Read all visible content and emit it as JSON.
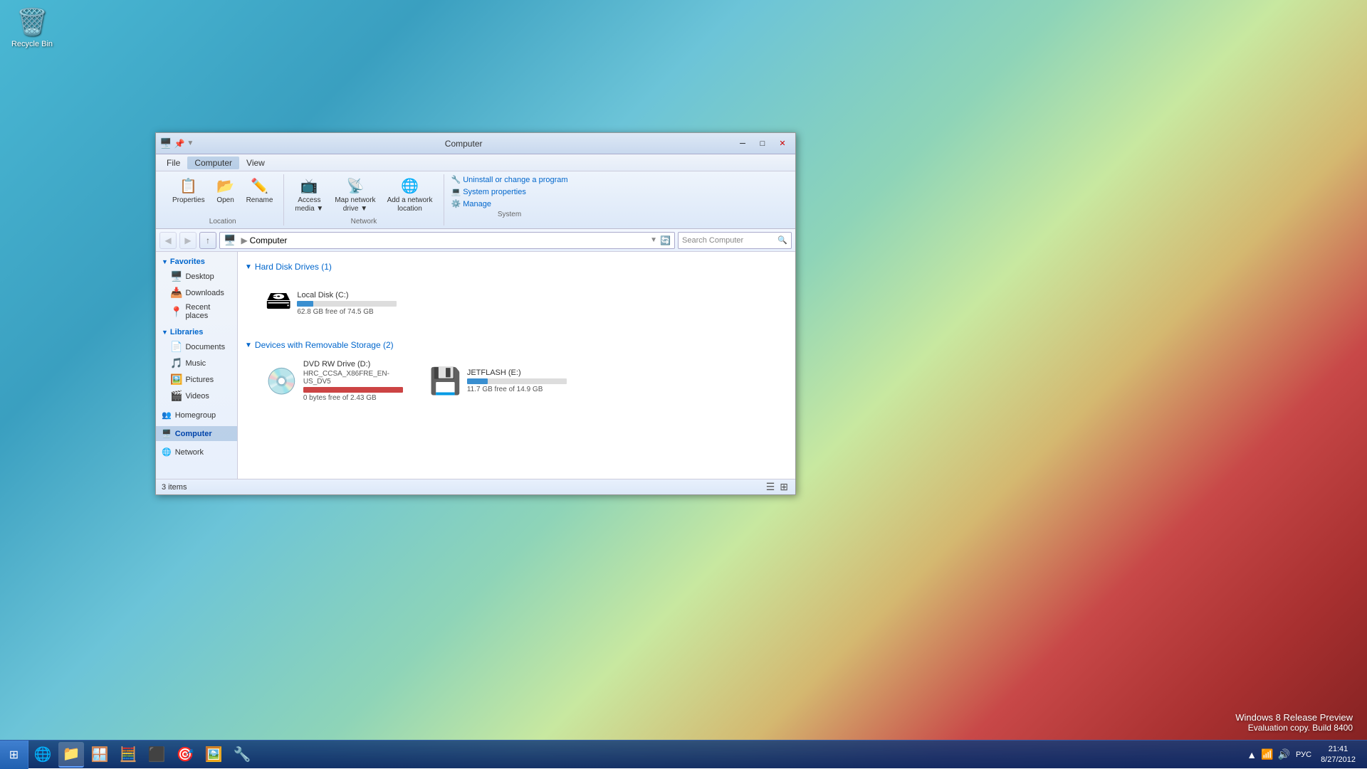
{
  "desktop": {
    "recycle_bin_label": "Recycle Bin"
  },
  "window": {
    "title": "Computer",
    "title_icon": "🖥️"
  },
  "titlebar": {
    "minimize": "─",
    "maximize": "□",
    "close": "✕"
  },
  "menubar": {
    "items": [
      "File",
      "Computer",
      "View"
    ]
  },
  "ribbon": {
    "location_group": {
      "label": "Location",
      "buttons": [
        {
          "icon": "📋",
          "label": "Properties"
        },
        {
          "icon": "📂",
          "label": "Open"
        },
        {
          "icon": "✏️",
          "label": "Rename"
        }
      ]
    },
    "network_group": {
      "label": "Network",
      "buttons": [
        {
          "icon": "🗺️",
          "label": "Access media"
        },
        {
          "icon": "📡",
          "label": "Map network drive"
        },
        {
          "icon": "🌐",
          "label": "Add a network location"
        }
      ]
    },
    "system_group": {
      "label": "System",
      "links": [
        "Uninstall or change a program",
        "System properties",
        "Manage"
      ]
    }
  },
  "navbar": {
    "address": "Computer",
    "search_placeholder": "Search Computer"
  },
  "sidebar": {
    "favorites_label": "Favorites",
    "favorites_items": [
      {
        "icon": "🖥️",
        "label": "Desktop"
      },
      {
        "icon": "📥",
        "label": "Downloads"
      },
      {
        "icon": "📍",
        "label": "Recent places"
      }
    ],
    "libraries_label": "Libraries",
    "libraries_items": [
      {
        "icon": "📄",
        "label": "Documents"
      },
      {
        "icon": "🎵",
        "label": "Music"
      },
      {
        "icon": "🖼️",
        "label": "Pictures"
      },
      {
        "icon": "🎬",
        "label": "Videos"
      }
    ],
    "homegroup_label": "Homegroup",
    "computer_label": "Computer",
    "network_label": "Network"
  },
  "content": {
    "hdd_section": "Hard Disk Drives (1)",
    "removable_section": "Devices with Removable Storage (2)",
    "drives": [
      {
        "name": "Local Disk (C:)",
        "icon": "💿",
        "size_label": "62.8 GB free of 74.5 GB",
        "fill_percent": 16,
        "color": "normal"
      }
    ],
    "removable": [
      {
        "name": "DVD RW Drive (D:)",
        "subtitle": "HRC_CCSA_X86FRE_EN-US_DV5",
        "icon": "💿",
        "size_label": "0 bytes free of 2.43 GB",
        "fill_percent": 100,
        "color": "red"
      },
      {
        "name": "JETFLASH (E:)",
        "icon": "💾",
        "size_label": "11.7 GB free of 14.9 GB",
        "fill_percent": 21,
        "color": "normal"
      }
    ]
  },
  "statusbar": {
    "count": "3 items"
  },
  "taskbar": {
    "items": [
      {
        "icon": "🌐",
        "label": "Internet Explorer"
      },
      {
        "icon": "📁",
        "label": "File Explorer",
        "active": true
      },
      {
        "icon": "🖥️",
        "label": "Windows"
      },
      {
        "icon": "🧮",
        "label": "Calculator"
      },
      {
        "icon": "⬛",
        "label": "Command Prompt"
      },
      {
        "icon": "🎯",
        "label": "App"
      },
      {
        "icon": "🖼️",
        "label": "Photo Viewer"
      },
      {
        "icon": "🔧",
        "label": "Settings"
      }
    ]
  },
  "systemtray": {
    "time": "21:41",
    "date": "8/27/2012",
    "language": "РУС"
  },
  "watermark": {
    "line1": "Windows 8 Release Preview",
    "line2": "Evaluation copy. Build 8400"
  }
}
